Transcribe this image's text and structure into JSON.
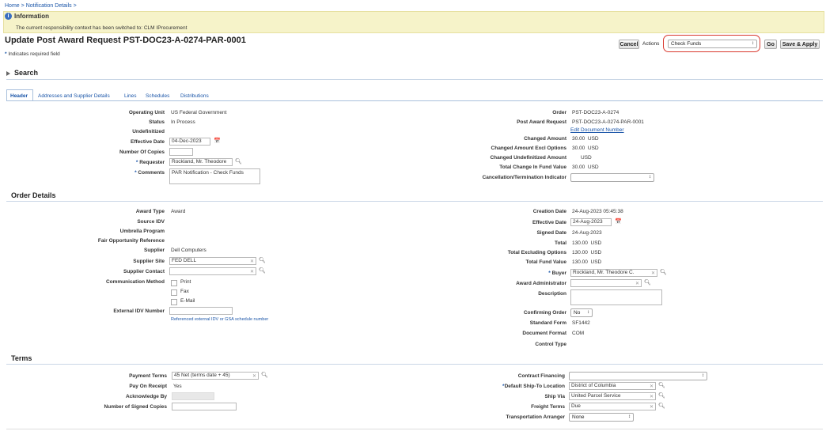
{
  "breadcrumb": {
    "home": "Home",
    "sep": ">",
    "current": "Notification Details",
    "sep2": ">"
  },
  "info": {
    "title": "Information",
    "message": "The current responsibility context has been switched to: CLM IProcurement"
  },
  "page_title": "Update Post Award Request PST-DOC23-A-0274-PAR-0001",
  "toolbar": {
    "cancel": "Cancel",
    "actions_label": "Actions",
    "actions_value": "Check Funds",
    "go": "Go",
    "save_apply": "Save & Apply"
  },
  "required_note": "Indicates required field",
  "search": {
    "label": "Search"
  },
  "tabs": [
    "Header",
    "Addresses and Supplier Details",
    "Lines",
    "Schedules",
    "Distributions"
  ],
  "header_left": {
    "operating_unit": {
      "label": "Operating Unit",
      "value": "US Federal Government"
    },
    "status": {
      "label": "Status",
      "value": "In Process"
    },
    "undefinitized": {
      "label": "Undefinitized",
      "value": ""
    },
    "effective_date": {
      "label": "Effective Date",
      "value": "04-Dec-2023"
    },
    "number_of_copies": {
      "label": "Number Of Copies",
      "value": ""
    },
    "requester": {
      "label": "Requester",
      "value": "Rockland, Mr. Theodore"
    },
    "comments": {
      "label": "Comments",
      "value": "PAR Notification - Check Funds"
    }
  },
  "header_right": {
    "order": {
      "label": "Order",
      "value": "PST-DOC23-A-0274"
    },
    "par": {
      "label": "Post Award Request",
      "value": "PST-DOC23-A-0274-PAR-0001"
    },
    "edit_doc": "Edit Document Number",
    "changed_amount": {
      "label": "Changed Amount",
      "value": "30.00",
      "currency": "USD"
    },
    "changed_excl": {
      "label": "Changed Amount Excl Options",
      "value": "30.00",
      "currency": "USD"
    },
    "changed_undef": {
      "label": "Changed Undefinitized Amount",
      "value": "",
      "currency": "USD"
    },
    "total_change_fund": {
      "label": "Total Change In Fund Value",
      "value": "30.00",
      "currency": "USD"
    },
    "cancellation": {
      "label": "Cancellation/Termination Indicator",
      "value": ""
    }
  },
  "order_details": {
    "title": "Order Details",
    "award_type": {
      "label": "Award Type",
      "value": "Award"
    },
    "source_idv": {
      "label": "Source IDV",
      "value": ""
    },
    "umbrella": {
      "label": "Umbrella Program",
      "value": ""
    },
    "fair_opp": {
      "label": "Fair Opportunity Reference",
      "value": ""
    },
    "supplier": {
      "label": "Supplier",
      "value": "Dell Computers"
    },
    "supplier_site": {
      "label": "Supplier Site",
      "value": "FED DELL"
    },
    "supplier_contact": {
      "label": "Supplier Contact",
      "value": ""
    },
    "comm_method": {
      "label": "Communication Method",
      "options": [
        "Print",
        "Fax",
        "E-Mail"
      ]
    },
    "external_idv": {
      "label": "External IDV Number",
      "value": "",
      "hint": "Referenced external IDV or GSA schedule number"
    },
    "creation_date": {
      "label": "Creation Date",
      "value": "24-Aug-2023 05:45:38"
    },
    "effective_date": {
      "label": "Effective Date",
      "value": "24-Aug-2023"
    },
    "signed_date": {
      "label": "Signed Date",
      "value": "24-Aug-2023"
    },
    "total": {
      "label": "Total",
      "value": "130.00",
      "currency": "USD"
    },
    "total_excl": {
      "label": "Total Excluding Options",
      "value": "130.00",
      "currency": "USD"
    },
    "total_fund": {
      "label": "Total Fund Value",
      "value": "130.00",
      "currency": "USD"
    },
    "buyer": {
      "label": "Buyer",
      "value": "Rockland, Mr. Theodore C."
    },
    "award_admin": {
      "label": "Award Administrator",
      "value": ""
    },
    "description": {
      "label": "Description",
      "value": ""
    },
    "confirming_order": {
      "label": "Confirming Order",
      "value": "No"
    },
    "standard_form": {
      "label": "Standard Form",
      "value": "SF1442"
    },
    "doc_format": {
      "label": "Document Format",
      "value": "COM"
    },
    "control_type": {
      "label": "Control Type",
      "value": ""
    }
  },
  "terms": {
    "title": "Terms",
    "payment_terms": {
      "label": "Payment Terms",
      "value": "45 Net (terms date + 45)"
    },
    "pay_on_receipt": {
      "label": "Pay On Receipt",
      "value": "Yes"
    },
    "ack_by": {
      "label": "Acknowledge By",
      "value": ""
    },
    "signed_copies": {
      "label": "Number of Signed Copies",
      "value": ""
    },
    "contract_financing": {
      "label": "Contract Financing",
      "value": ""
    },
    "default_ship_to": {
      "label": "Default Ship-To Location",
      "value": "District of Columbia"
    },
    "ship_via": {
      "label": "Ship Via",
      "value": "United Parcel Service"
    },
    "freight_terms": {
      "label": "Freight Terms",
      "value": "Due"
    },
    "transport_arranger": {
      "label": "Transportation Arranger",
      "value": "None"
    }
  }
}
